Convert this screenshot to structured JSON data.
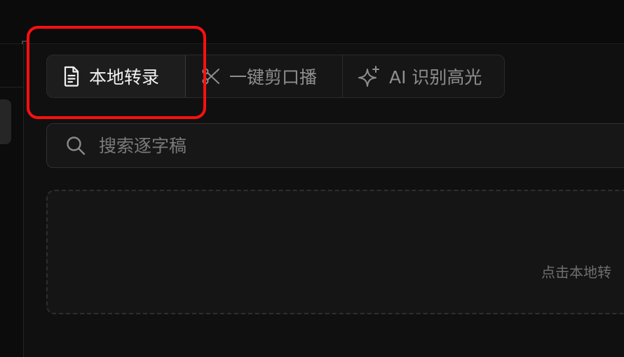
{
  "tabs": [
    {
      "label": "本地转录",
      "icon": "document-icon",
      "active": true
    },
    {
      "label": "一键剪口播",
      "icon": "scissors-icon",
      "active": false
    },
    {
      "label": "AI 识别高光",
      "icon": "sparkle-icon",
      "active": false
    }
  ],
  "search": {
    "placeholder": "搜索逐字稿",
    "icon": "search-icon"
  },
  "dropzone": {
    "hint": "点击本地转"
  },
  "colors": {
    "background": "#0d0d0d",
    "highlight": "#ff1010",
    "active_text": "#f2f2f2",
    "inactive_text": "#8e8e8e"
  }
}
